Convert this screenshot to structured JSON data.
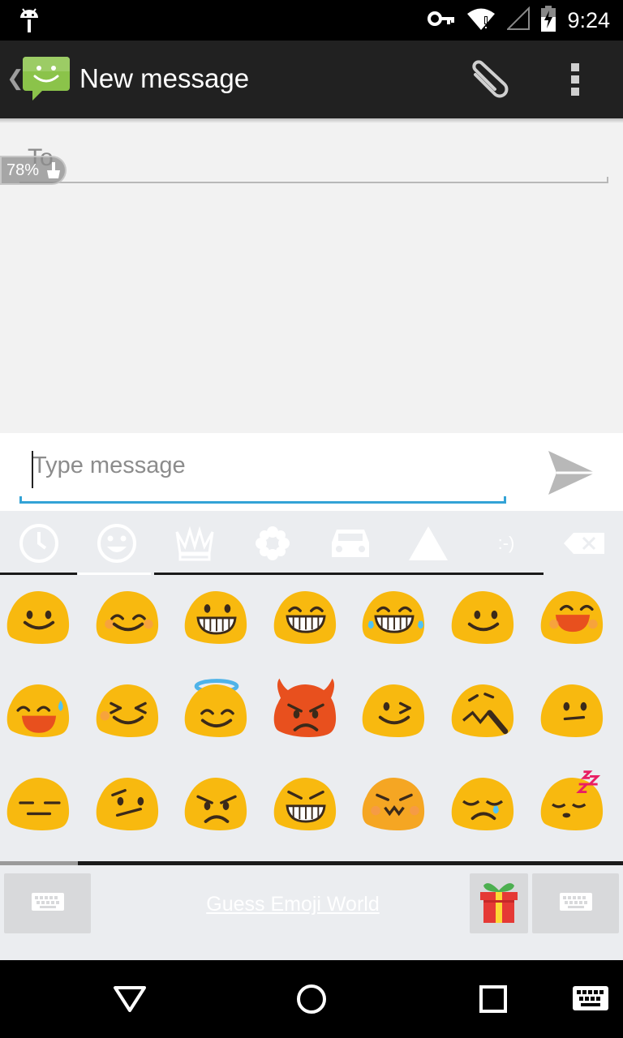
{
  "status_bar": {
    "time": "9:24",
    "icons": [
      "android-debug-icon",
      "key-icon",
      "wifi-alert-icon",
      "signal-icon",
      "battery-charging-icon"
    ]
  },
  "action_bar": {
    "back_icon": "back-chevron-icon",
    "app_icon": "messaging-app-icon",
    "title": "New message",
    "actions": [
      "attach-icon",
      "overflow-menu-icon"
    ]
  },
  "recipient": {
    "label": "To",
    "battery_overlay_percent": "78%"
  },
  "compose": {
    "placeholder": "Type message",
    "value": "",
    "send_icon": "send-icon"
  },
  "emoji_keyboard": {
    "categories": [
      {
        "icon": "recent-clock-icon",
        "active": false
      },
      {
        "icon": "smiley-face-icon",
        "active": true
      },
      {
        "icon": "crown-icon",
        "active": false
      },
      {
        "icon": "flower-icon",
        "active": false
      },
      {
        "icon": "car-icon",
        "active": false
      },
      {
        "icon": "triangle-symbol-icon",
        "active": false
      },
      {
        "icon": "emoticon-text-icon",
        "label": ":-)",
        "active": false
      },
      {
        "icon": "backspace-icon",
        "active": false
      }
    ],
    "emojis": [
      "smiling-face",
      "smiling-face-blush",
      "grinning-face",
      "grinning-face-smiling-eyes",
      "face-tears-of-joy",
      "slightly-smiling-face",
      "laughing-face",
      "laughing-sweat-face",
      "squinting-tongue-face",
      "halo-face",
      "angry-devil-face",
      "winking-face",
      "confounded-face",
      "neutral-face",
      "expressionless-face",
      "confused-face",
      "angry-face",
      "grimacing-face",
      "pouting-face",
      "crying-face",
      "sleeping-face"
    ],
    "bottom_bar": {
      "left_key_icon": "keyboard-icon",
      "link_text": "Guess Emoji World",
      "gift_icon": "gift-icon",
      "right_key_icon": "keyboard-icon"
    }
  },
  "nav_bar": {
    "buttons": [
      "back-nav-icon",
      "home-nav-icon",
      "recents-nav-icon",
      "keyboard-switch-icon"
    ]
  },
  "colors": {
    "action_bar": "#212121",
    "content_bg": "#f2f2f2",
    "accent": "#33a3d6",
    "keyboard_bg": "#ebedf0",
    "emoji_yellow": "#f8b90f",
    "app_icon_green": "#8bc34a"
  }
}
